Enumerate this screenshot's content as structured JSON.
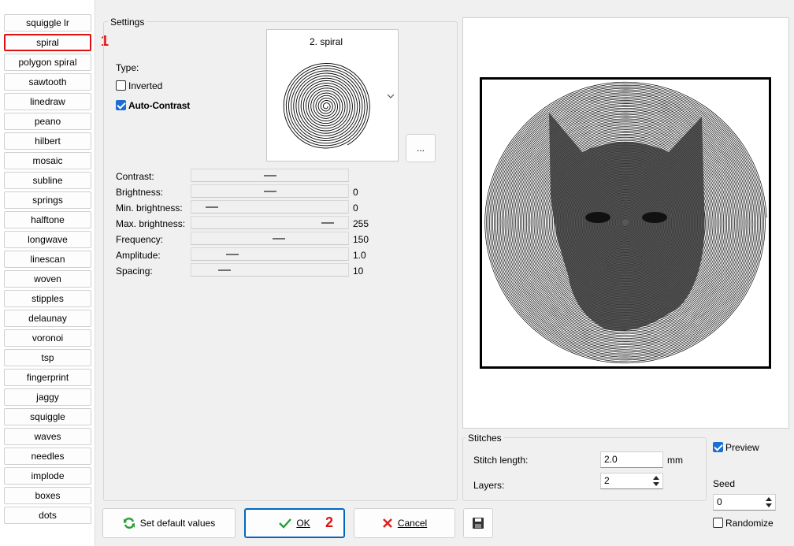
{
  "algorithms": [
    {
      "label": "squiggle lr"
    },
    {
      "label": "spiral",
      "selected": true
    },
    {
      "label": "polygon spiral"
    },
    {
      "label": "sawtooth"
    },
    {
      "label": "linedraw"
    },
    {
      "label": "peano"
    },
    {
      "label": "hilbert"
    },
    {
      "label": "mosaic"
    },
    {
      "label": "subline"
    },
    {
      "label": "springs"
    },
    {
      "label": "halftone"
    },
    {
      "label": "longwave"
    },
    {
      "label": "linescan"
    },
    {
      "label": "woven"
    },
    {
      "label": "stipples"
    },
    {
      "label": "delaunay"
    },
    {
      "label": "voronoi"
    },
    {
      "label": "tsp"
    },
    {
      "label": "fingerprint"
    },
    {
      "label": "jaggy"
    },
    {
      "label": "squiggle"
    },
    {
      "label": "waves"
    },
    {
      "label": "needles"
    },
    {
      "label": "implode"
    },
    {
      "label": "boxes"
    },
    {
      "label": "dots"
    }
  ],
  "markers": {
    "selection": "1",
    "ok": "2"
  },
  "settings": {
    "title": "Settings",
    "type_label": "Type:",
    "type_selected": "2. spiral",
    "more_button": "...",
    "inverted": {
      "label": "Inverted",
      "checked": false
    },
    "auto_contrast": {
      "label": "Auto-Contrast",
      "checked": true
    },
    "sliders": [
      {
        "label": "Contrast:",
        "value": "",
        "position": 0.5
      },
      {
        "label": "Brightness:",
        "value": "0",
        "position": 0.5
      },
      {
        "label": "Min. brightness:",
        "value": "0",
        "position": 0.13
      },
      {
        "label": "Max. brightness:",
        "value": "255",
        "position": 0.87
      },
      {
        "label": "Frequency:",
        "value": "150",
        "position": 0.56
      },
      {
        "label": "Amplitude:",
        "value": "1.0",
        "position": 0.26
      },
      {
        "label": "Spacing:",
        "value": "10",
        "position": 0.21
      }
    ]
  },
  "stitches": {
    "title": "Stitches",
    "stitch_length_label": "Stitch length:",
    "stitch_length_value": "2.0",
    "stitch_length_unit": "mm",
    "layers_label": "Layers:",
    "layers_value": "2"
  },
  "options": {
    "preview": {
      "label": "Preview",
      "checked": true
    },
    "seed_label": "Seed",
    "seed_value": "0",
    "randomize": {
      "label": "Randomize",
      "checked": false
    }
  },
  "buttons": {
    "set_default": "Set default values",
    "ok": "OK",
    "cancel": "Cancel"
  },
  "colors": {
    "selection_border": "#e01010",
    "accent": "#0067c0",
    "checkbox": "#1a6fd1"
  }
}
